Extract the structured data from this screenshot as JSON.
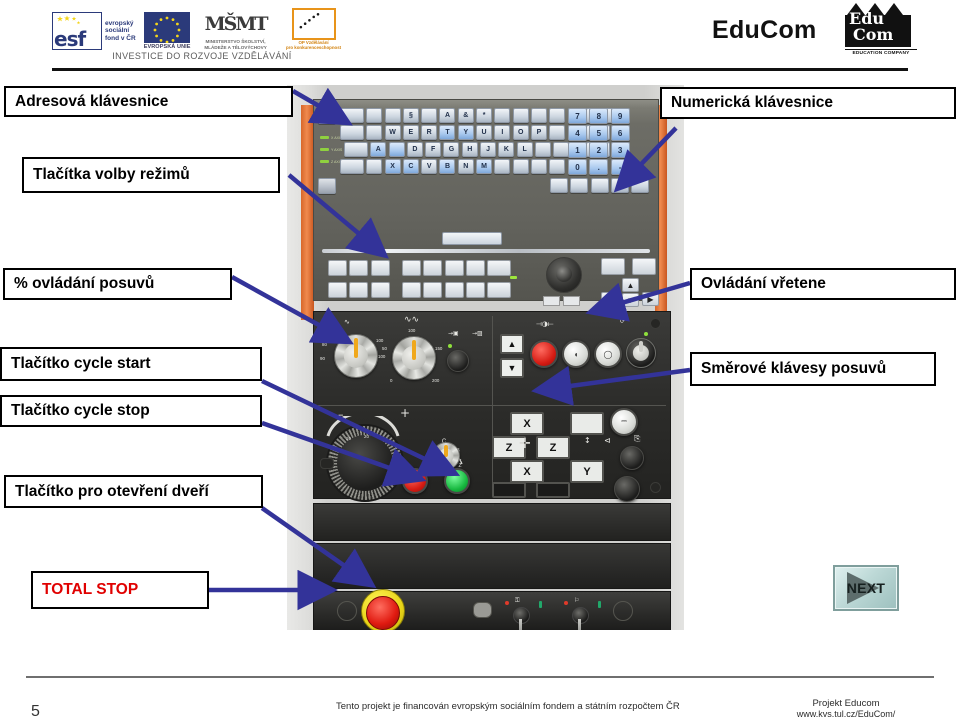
{
  "header": {
    "title": "EduCom",
    "brand_caption": "EDUCATION COMPANY",
    "brand_mark_top": "Edu",
    "brand_mark_bottom": "Com",
    "esf_line1": "evropský",
    "esf_line2": "sociální",
    "esf_line3": "fond v ČR",
    "esf_mark": "esf",
    "eu_caption": "EVROPSKÁ UNIE",
    "msmt_mark": "MŠMT",
    "msmt_caption": "MINISTERSTVO ŠKOLSTVÍ, MLÁDEŽE A TĚLOVÝCHOVY",
    "op_caption_1": "OP Vzdělávání",
    "op_caption_2": "pro konkurenceschopnost",
    "investice": "INVESTICE DO ROZVOJE VZDĚLÁVÁNÍ"
  },
  "labels": {
    "left": [
      {
        "id": "adresova-klavesnice",
        "text": "Adresová klávesnice"
      },
      {
        "id": "tlacitka-volby-rezimu",
        "text": "Tlačítka volby režimů"
      },
      {
        "id": "ovladani-posuvu",
        "text": "% ovládání posuvů"
      },
      {
        "id": "tlacitko-cycle-start",
        "text": "Tlačítko cycle start"
      },
      {
        "id": "tlacitko-cycle-stop",
        "text": "Tlačítko cycle stop"
      },
      {
        "id": "tlacitko-otevreni-dveri",
        "text": "Tlačítko pro otevření dveří"
      },
      {
        "id": "total-stop",
        "text": "TOTAL STOP"
      }
    ],
    "right": [
      {
        "id": "numericka-klavesnice",
        "text": "Numerická klávesnice"
      },
      {
        "id": "ovladani-vretene",
        "text": "Ovládání vřetene"
      },
      {
        "id": "smerove-klavesy-posuvu",
        "text": "Směrové klávesy posuvů"
      }
    ]
  },
  "colors": {
    "arrow": "#333399",
    "total_stop_text": "#e00000",
    "box_border": "#000000",
    "rule": "#111111"
  },
  "next_button": {
    "label": "NEXT"
  },
  "machine": {
    "keyboard_rows": [
      [
        "",
        "",
        "",
        "",
        "§",
        "",
        "A",
        "&",
        "*",
        "",
        "",
        "",
        "",
        "",
        "",
        ""
      ],
      [
        "",
        "",
        "W",
        "E",
        "R",
        "T",
        "Y",
        "U",
        "I",
        "O",
        "P",
        "",
        "",
        "",
        ""
      ],
      [
        "",
        "A",
        "",
        "D",
        "F",
        "G",
        "H",
        "J",
        "K",
        "L",
        "",
        "",
        ""
      ],
      [
        "",
        "",
        "",
        "X",
        "C",
        "V",
        "B",
        "N",
        "M",
        "",
        "",
        "",
        "",
        "",
        ""
      ]
    ],
    "numpad": [
      [
        "7",
        "8",
        "9"
      ],
      [
        "4",
        "5",
        "6"
      ],
      [
        "1",
        "2",
        "3"
      ],
      [
        "0",
        ".",
        "-"
      ]
    ],
    "axis_keys": [
      "X",
      "Z",
      "Z",
      "X",
      "Y"
    ],
    "dial_left_values": [
      "50",
      "80",
      "90",
      "100",
      "10"
    ],
    "dial_right_values": [
      "0",
      "50",
      "100",
      "150",
      "200"
    ],
    "jog_marks": [
      "-",
      "+"
    ],
    "spindle_selector": "C",
    "buttons": {
      "cycle_start": "start",
      "cycle_stop": "stop"
    }
  },
  "footer": {
    "page": "5",
    "center": "Tento projekt je financován evropským sociálním fondem a státním rozpočtem ČR",
    "right_line1": "Projekt Educom",
    "right_line2": "www.kvs.tul.cz/EduCom/"
  }
}
